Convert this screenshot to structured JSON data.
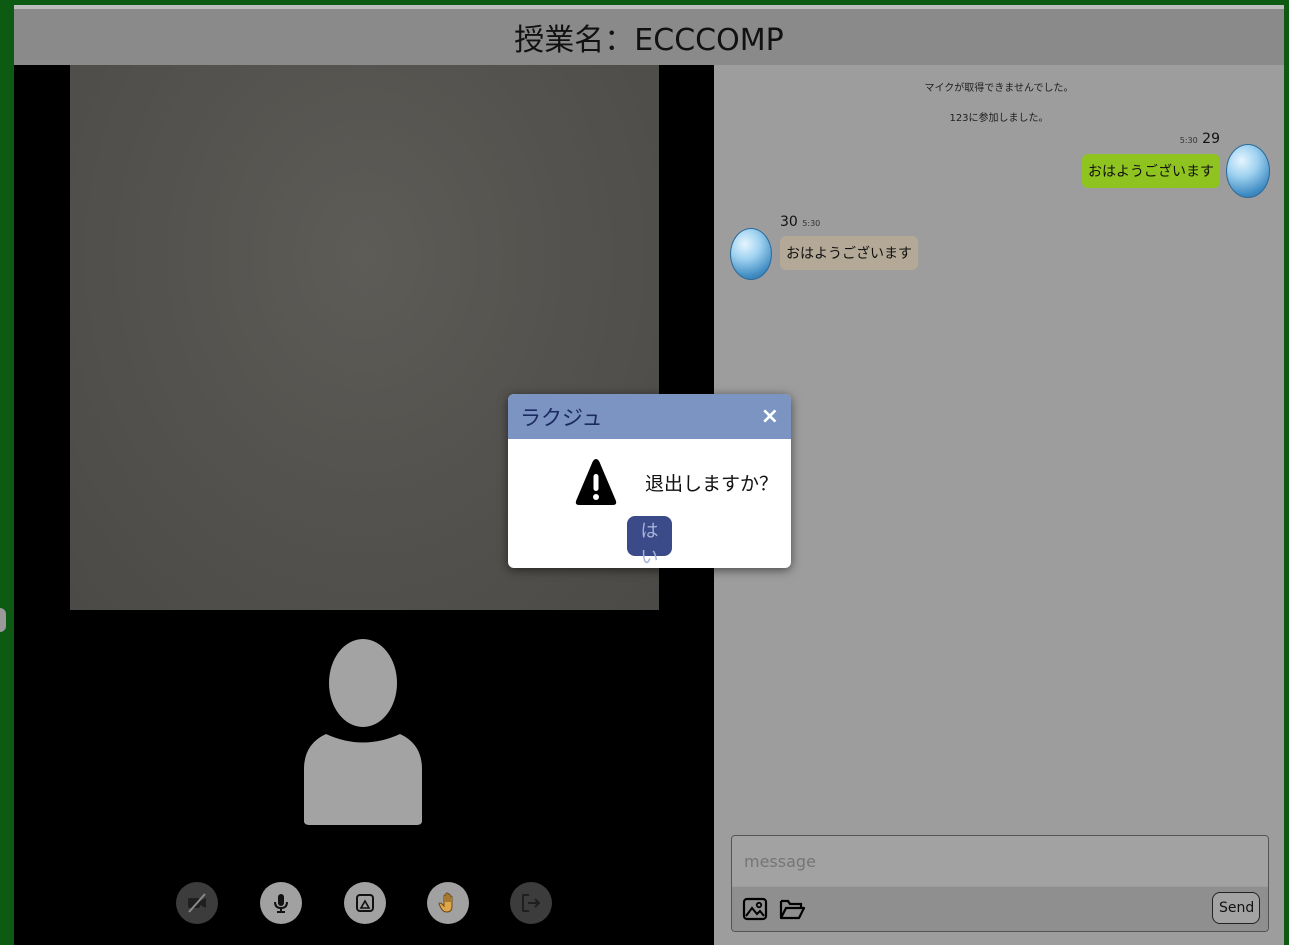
{
  "header": {
    "title": "授業名：ECCCOMP"
  },
  "controls": [
    {
      "name": "camera-off-icon"
    },
    {
      "name": "microphone-icon"
    },
    {
      "name": "screen-share-icon"
    },
    {
      "name": "raise-hand-icon"
    },
    {
      "name": "exit-icon"
    }
  ],
  "chat": {
    "system_messages": [
      "マイクが取得できませんでした。",
      "123に参加しました。"
    ],
    "messages": [
      {
        "side": "right",
        "user": "29",
        "time": "5:30",
        "text": "おはようございます",
        "color": "#8fc31f"
      },
      {
        "side": "left",
        "user": "30",
        "time": "5:30",
        "text": "おはようございます",
        "color": "#b3a996"
      }
    ],
    "input_placeholder": "message",
    "send_label": "Send"
  },
  "modal": {
    "title": "ラクジュ",
    "close_label": "×",
    "text": "退出しますか？",
    "yes_label": "はい"
  },
  "colors": {
    "background": "#0d5b12",
    "header": "#8a8a8a",
    "modal_header": "#7c94c1",
    "yes_button": "#3b4a89"
  }
}
